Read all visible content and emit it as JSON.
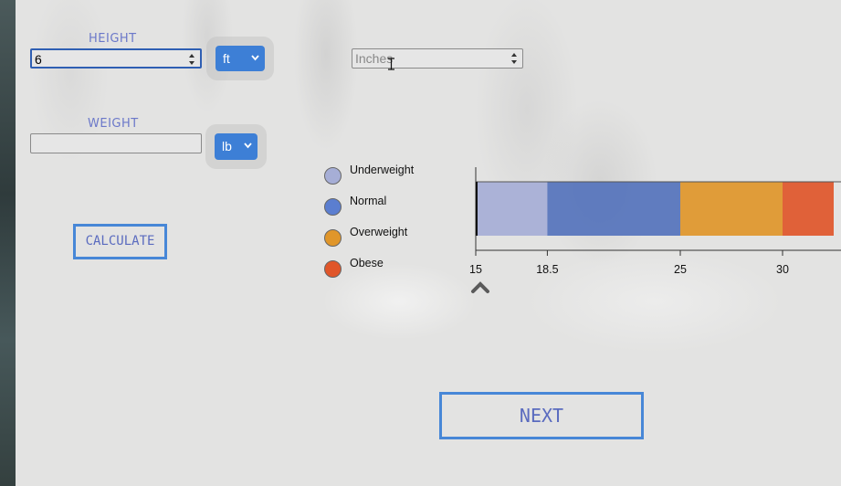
{
  "form": {
    "height_label": "HEIGHT",
    "height_value": "6",
    "height_unit": "ft",
    "inches_placeholder": "Inches",
    "weight_label": "WEIGHT",
    "weight_value": "",
    "weight_unit": "lb",
    "calculate_label": "CALCULATE",
    "next_label": "NEXT"
  },
  "legend": [
    {
      "label": "Underweight",
      "color": "#a6aed6"
    },
    {
      "label": "Normal",
      "color": "#5b7ed0"
    },
    {
      "label": "Overweight",
      "color": "#e0962a"
    },
    {
      "label": "Obese",
      "color": "#e0562a"
    }
  ],
  "chart_data": {
    "type": "bar",
    "xlim": [
      15,
      32.5
    ],
    "ranges": [
      {
        "name": "Underweight",
        "from": 15,
        "to": 18.5,
        "color": "#a6aed6"
      },
      {
        "name": "Normal",
        "from": 18.5,
        "to": 25,
        "color": "#5b7ed0"
      },
      {
        "name": "Overweight",
        "from": 25,
        "to": 30,
        "color": "#e0962a"
      },
      {
        "name": "Obese",
        "from": 30,
        "to": 32.5,
        "color": "#e0562a"
      }
    ],
    "ticks": [
      "15",
      "18.5",
      "25",
      "30"
    ],
    "tick_values": [
      15,
      18.5,
      25,
      30
    ],
    "marker_value": 15
  },
  "colors": {
    "accent": "#3d7fd6",
    "label": "#6b78c9"
  }
}
